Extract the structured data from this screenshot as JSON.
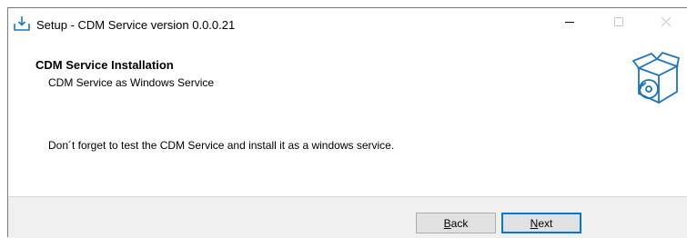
{
  "window": {
    "title": "Setup - CDM Service version 0.0.0.21",
    "icon": "download-setup-icon",
    "controls": [
      "minimize-icon",
      "maximize-icon",
      "close-icon"
    ]
  },
  "header": {
    "title": "CDM Service Installation",
    "subtitle": "CDM Service as Windows Service",
    "icon": "box-cd-icon"
  },
  "content": {
    "message": "Don´t forget to test the CDM Service and install it as a windows service."
  },
  "buttons": {
    "back": {
      "accel": "B",
      "rest": "ack"
    },
    "next": {
      "accel": "N",
      "rest": "ext"
    }
  },
  "colors": {
    "accent": "#0078d7",
    "footer_bg": "#f0f0f0",
    "button_bg": "#e1e1e1"
  }
}
